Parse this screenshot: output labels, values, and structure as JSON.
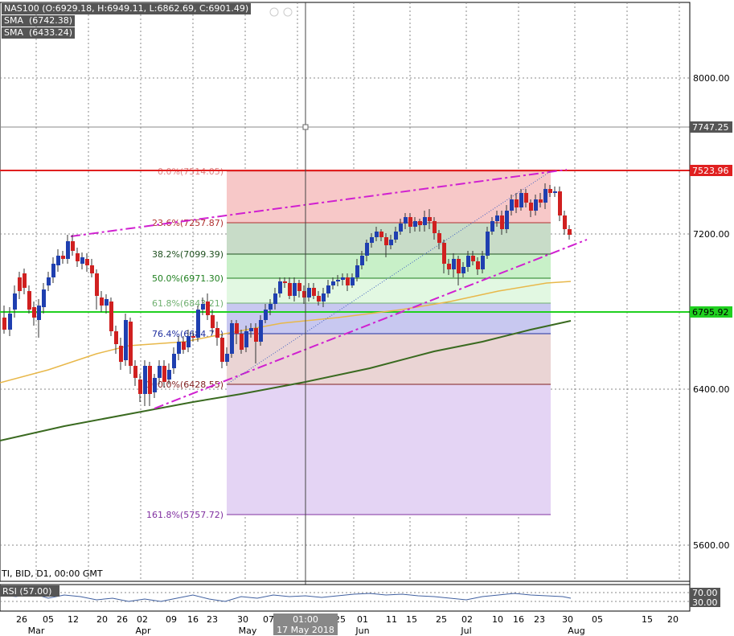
{
  "header": {
    "ohlc": "NAS100 (O:6929.18, H:6949.11, L:6862.69, C:6901.49)",
    "sma1": "SMA  (6742.38)",
    "sma2": "SMA  (6433.24)"
  },
  "footer": {
    "info": "TI, BID, D1, 00:00 GMT"
  },
  "rsi": {
    "label": "RSI  (57.00)",
    "upper": "70.00",
    "lower": "30.00"
  },
  "price_axis": {
    "ticks": [
      "8000.00",
      "7200.00",
      "6400.00",
      "5600.00"
    ],
    "marker_grey": "7747.25",
    "marker_red": "7523.96",
    "marker_green": "6795.92"
  },
  "fib_levels": [
    {
      "label": "0.0%(7514.05)",
      "color": "#e08080"
    },
    {
      "label": "23.6%(7257.87)",
      "color": "#b03030"
    },
    {
      "label": "38.2%(7099.39)",
      "color": "#205020"
    },
    {
      "label": "50.0%(6971.30)",
      "color": "#208020"
    },
    {
      "label": "61.8%(6843.21)",
      "color": "#70b070"
    },
    {
      "label": "76.4%(6684.73)",
      "color": "#2030a0"
    },
    {
      "label": "100.0%(6428.55)",
      "color": "#802020"
    },
    {
      "label": "161.8%(5757.72)",
      "color": "#8030a0"
    }
  ],
  "time_axis": {
    "days": [
      "26",
      "05",
      "12",
      "20",
      "26",
      "02",
      "09",
      "16",
      "23",
      "30",
      "07",
      "25",
      "01",
      "11",
      "15",
      "25",
      "02",
      "10",
      "16",
      "23",
      "30",
      "05",
      "15",
      "20"
    ],
    "months": [
      "Mar",
      "Apr",
      "May",
      "Jun",
      "Jul",
      "Aug"
    ],
    "crosshair_time": "01:00",
    "crosshair_date": "17 May 2018"
  },
  "colors": {
    "bull": "#1f3fb0",
    "bear": "#d02020",
    "sma_fast": "#e8b84a",
    "sma_slow": "#3a6a20",
    "channel": "#d020d0",
    "red_line": "#e02020",
    "green_line": "#20d020"
  }
}
